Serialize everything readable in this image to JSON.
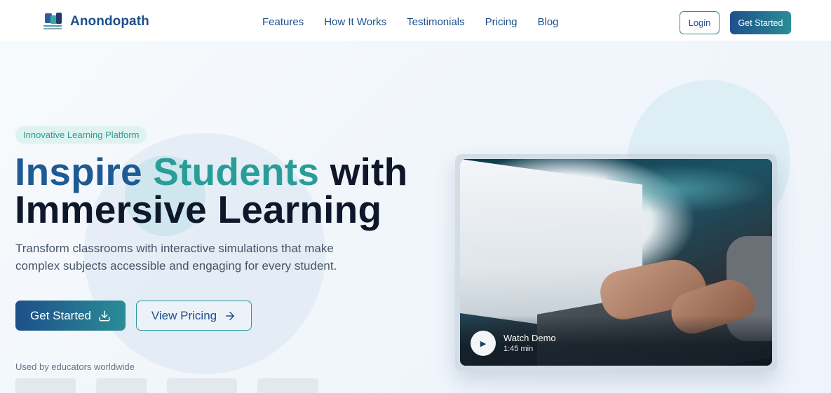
{
  "brand": {
    "name": "Anondopath"
  },
  "nav": {
    "links": [
      "Features",
      "How It Works",
      "Testimonials",
      "Pricing",
      "Blog"
    ],
    "login_label": "Login",
    "get_started_label": "Get Started"
  },
  "hero": {
    "tag": "Innovative Learning Platform",
    "headline_part1": "Inspire",
    "headline_part2": "Students",
    "headline_part3": "with",
    "headline_line2": "Immersive Learning",
    "subtext": "Transform classrooms with interactive simulations that make complex subjects accessible and engaging for every student.",
    "primary_button": "Get Started",
    "secondary_button": "View Pricing",
    "used_by": "Used by educators worldwide"
  },
  "video": {
    "title": "Watch Demo",
    "duration": "1:45 min",
    "play_icon": "play-icon"
  },
  "colors": {
    "brand_blue": "#1e4f8a",
    "brand_teal": "#2a9d99",
    "headline_dark": "#0f172a"
  }
}
